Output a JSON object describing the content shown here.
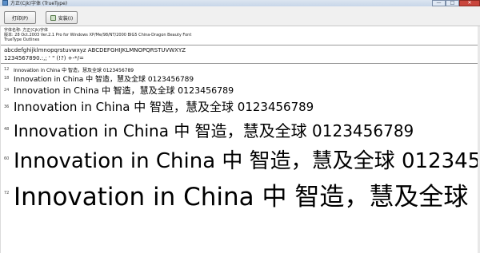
{
  "window": {
    "title": "方正(Cjk)字体 (TrueType)",
    "minimize": "—",
    "maximize": "□",
    "close": "✕"
  },
  "toolbar": {
    "print_label": "打印(P)",
    "install_label": "安装(I)"
  },
  "font_info": {
    "name_line": "字体名称: 方正(Cjk)字体",
    "version_line": "版本: 28 Oct.2003 Ver.2.1 Pro for Windows XP/Me/98/NT/2000 BIG5 China-Dragon Beauty Font",
    "outline_line": "TrueType Outlines"
  },
  "charset": {
    "lower": "abcdefghijklmnopqrstuvwxyz ABCDEFGHIJKLMNOPQRSTUVWXYZ",
    "digits": "1234567890.:,; ' \" (!?) +-*/=",
    "sample_text": "Innovation in China 中 智造，慧及全球 0123456789"
  },
  "samples": [
    {
      "size": "12"
    },
    {
      "size": "18"
    },
    {
      "size": "24"
    },
    {
      "size": "36"
    },
    {
      "size": "48"
    },
    {
      "size": "60"
    },
    {
      "size": "72"
    }
  ]
}
